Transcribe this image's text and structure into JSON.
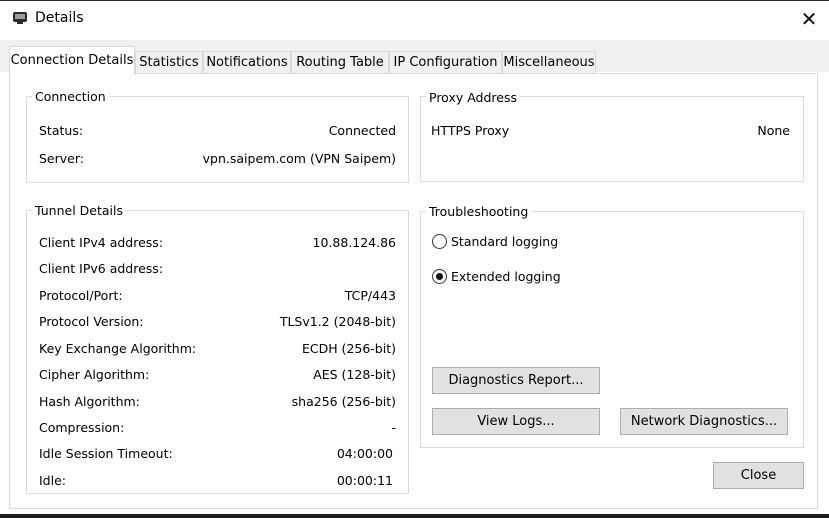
{
  "window": {
    "title": "Details"
  },
  "tabs": [
    {
      "label": "Connection Details",
      "active": true
    },
    {
      "label": "Statistics",
      "active": false
    },
    {
      "label": "Notifications",
      "active": false
    },
    {
      "label": "Routing Table",
      "active": false
    },
    {
      "label": "IP Configuration",
      "active": false
    },
    {
      "label": "Miscellaneous",
      "active": false
    }
  ],
  "connection": {
    "title": "Connection",
    "rows": [
      {
        "label": "Status:",
        "value": "Connected"
      },
      {
        "label": "Server:",
        "value": "vpn.saipem.com (VPN Saipem)"
      }
    ]
  },
  "proxy": {
    "title": "Proxy Address",
    "rows": [
      {
        "label": "HTTPS Proxy",
        "value": "None"
      }
    ]
  },
  "tunnel": {
    "title": "Tunnel Details",
    "rows": [
      {
        "label": "Client IPv4 address:",
        "value": "10.88.124.86"
      },
      {
        "label": "Client IPv6 address:",
        "value": ""
      },
      {
        "label": "Protocol/Port:",
        "value": "TCP/443"
      },
      {
        "label": "Protocol Version:",
        "value": "TLSv1.2 (2048-bit)"
      },
      {
        "label": "Key Exchange Algorithm:",
        "value": "ECDH (256-bit)"
      },
      {
        "label": "Cipher Algorithm:",
        "value": "AES (128-bit)"
      },
      {
        "label": "Hash Algorithm:",
        "value": "sha256 (256-bit)"
      },
      {
        "label": "Compression:",
        "value": "-"
      },
      {
        "label": "Idle Session Timeout:",
        "value": "04:00:00"
      },
      {
        "label": "Idle:",
        "value": "00:00:11"
      }
    ]
  },
  "troubleshooting": {
    "title": "Troubleshooting",
    "options": [
      {
        "label": "Standard logging",
        "selected": false
      },
      {
        "label": "Extended logging",
        "selected": true
      }
    ],
    "diagnostics_report_label": "Diagnostics Report...",
    "view_logs_label": "View Logs...",
    "network_diagnostics_label": "Network Diagnostics..."
  },
  "close_button_label": "Close"
}
